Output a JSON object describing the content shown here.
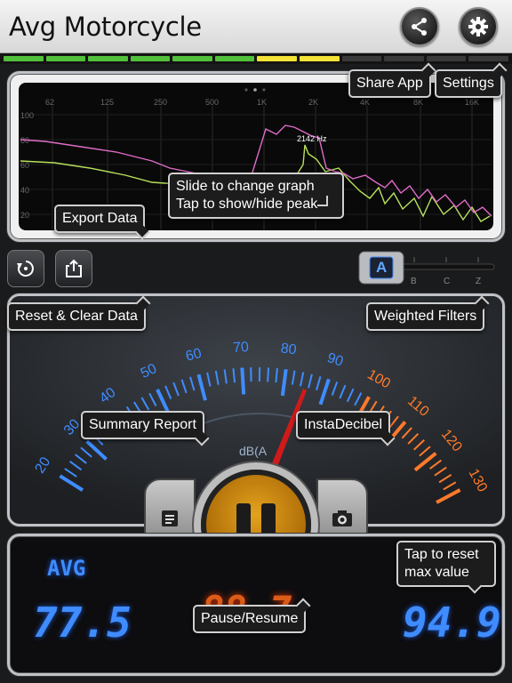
{
  "header": {
    "title": "Avg Motorcycle",
    "share_icon": "share-icon",
    "settings_icon": "gear-icon"
  },
  "level_meter": {
    "segments": [
      "#51c13b",
      "#51c13b",
      "#51c13b",
      "#51c13b",
      "#51c13b",
      "#51c13b",
      "#f2e336",
      "#f2e336",
      "#3a3a3a",
      "#3a3a3a",
      "#3a3a3a",
      "#3a3a3a"
    ]
  },
  "graph": {
    "freq_ticks": [
      "62",
      "125",
      "250",
      "500",
      "1K",
      "2K",
      "4K",
      "8K",
      "16K"
    ],
    "db_ticks": [
      "100",
      "80",
      "60",
      "40",
      "20"
    ],
    "peak_label": "2142 Hz"
  },
  "toolbar": {
    "reset_icon": "reset-icon",
    "export_icon": "export-icon"
  },
  "filters": {
    "options": [
      "A",
      "B",
      "C",
      "Z"
    ],
    "selected": "A"
  },
  "gauge": {
    "blue_ticks": [
      "20",
      "30",
      "40",
      "50",
      "60",
      "70",
      "80",
      "90"
    ],
    "orange_ticks": [
      "100",
      "110",
      "120",
      "130"
    ],
    "unit": "dB(A"
  },
  "readout": {
    "avg_label": "AVG",
    "avg_value": "77.5",
    "max_value": "94.9",
    "current_value": "88.7"
  },
  "callouts": {
    "share_app": "Share App",
    "settings": "Settings",
    "slide_graph": "Slide to change graph Tap to show/hide peak",
    "export_data": "Export Data",
    "reset_clear": "Reset & Clear Data",
    "weighted_filters": "Weighted Filters",
    "summary_report": "Summary Report",
    "instadecibel": "InstaDecibel",
    "tap_reset": "Tap to reset max value",
    "pause_resume": "Pause/Resume"
  },
  "colors": {
    "accent_blue": "#3f8cff",
    "accent_orange": "#ff7a2a",
    "pause_orange": "#e39a18"
  }
}
